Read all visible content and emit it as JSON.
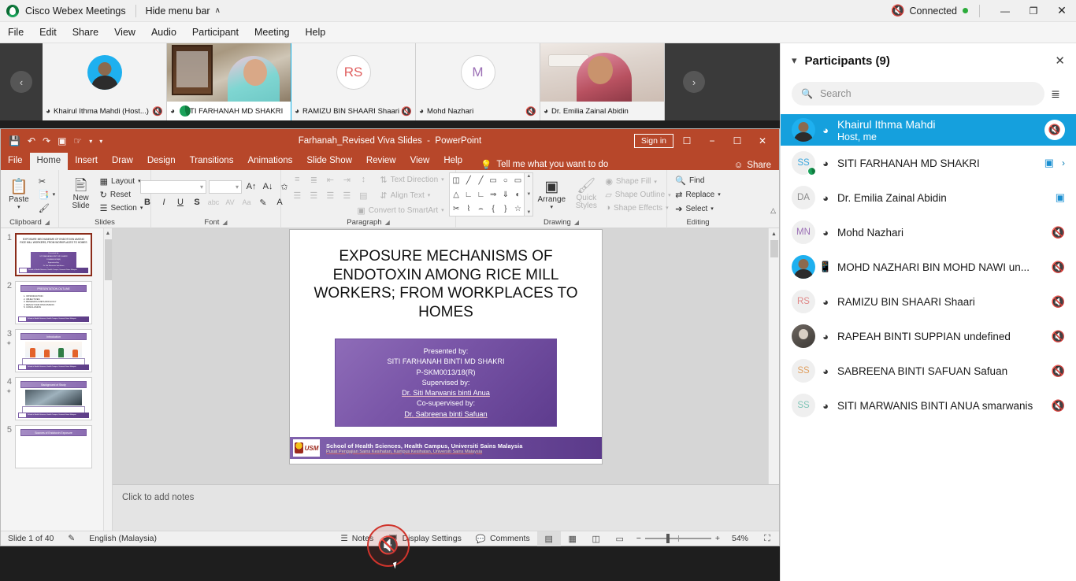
{
  "webex": {
    "app_title": "Cisco Webex Meetings",
    "hide_menu_label": "Hide menu bar",
    "chevron": "∧",
    "connection_status": "Connected",
    "menus": [
      "File",
      "Edit",
      "Share",
      "View",
      "Audio",
      "Participant",
      "Meeting",
      "Help"
    ],
    "window_controls": {
      "minimize": "—",
      "restore": "❐",
      "close": "✕"
    }
  },
  "filmstrip": {
    "prev_label": "‹",
    "next_label": "›",
    "tiles": [
      {
        "name": "Khairul Ithma Mahdi",
        "suffix": "(Host...)",
        "initials": "",
        "muted": true,
        "video": false,
        "avatar": "photo"
      },
      {
        "name": "SITI FARHANAH MD SHAKRI",
        "suffix": "",
        "initials": "",
        "muted": false,
        "video": true,
        "avatar": "video-a"
      },
      {
        "name": "RAMIZU BIN SHAARI Shaari",
        "suffix": "",
        "initials": "RS",
        "muted": true,
        "video": false,
        "avatar": "initials"
      },
      {
        "name": "Mohd Nazhari",
        "suffix": "",
        "initials": "M",
        "muted": true,
        "video": false,
        "avatar": "initials"
      },
      {
        "name": "Dr. Emilia Zainal Abidin",
        "suffix": "",
        "initials": "",
        "muted": false,
        "video": true,
        "avatar": "video-b"
      }
    ]
  },
  "powerpoint": {
    "document_name": "Farhanah_Revised Viva Slides",
    "app_suffix": "PowerPoint",
    "sign_in": "Sign in",
    "share": "Share",
    "tell_me": "Tell me what you want to do",
    "tabs": [
      "File",
      "Home",
      "Insert",
      "Draw",
      "Design",
      "Transitions",
      "Animations",
      "Slide Show",
      "Review",
      "View",
      "Help"
    ],
    "active_tab": "Home",
    "ribbon_groups": [
      {
        "label": "Clipboard",
        "items": [
          "Paste",
          "Cut",
          "Copy",
          "Format Painter"
        ]
      },
      {
        "label": "Slides",
        "items": [
          "New Slide",
          "Layout",
          "Reset",
          "Section"
        ]
      },
      {
        "label": "Font",
        "items": [
          "Bold",
          "Italic",
          "Underline",
          "Shadow",
          "Strikethrough",
          "Character Spacing",
          "Change Case",
          "Text Highlight Color",
          "Font Color"
        ]
      },
      {
        "label": "Paragraph",
        "items": [
          "Bullets",
          "Numbering",
          "Decrease Indent",
          "Increase Indent",
          "Line Spacing",
          "Text Direction",
          "Align Text",
          "Convert to SmartArt"
        ]
      },
      {
        "label": "Drawing",
        "items": [
          "Arrange",
          "Quick Styles",
          "Shape Fill",
          "Shape Outline",
          "Shape Effects"
        ]
      },
      {
        "label": "Editing",
        "items": [
          "Find",
          "Replace",
          "Select"
        ]
      }
    ],
    "font_group_labels": {
      "text_direction": "Text Direction",
      "align_text": "Align Text",
      "convert_smartart": "Convert to SmartArt"
    },
    "drawing_labels": {
      "arrange": "Arrange",
      "quick_styles": "Quick Styles",
      "shape_fill": "Shape Fill",
      "shape_outline": "Shape Outline",
      "shape_effects": "Shape Effects"
    },
    "editing_labels": {
      "find": "Find",
      "replace": "Replace",
      "select": "Select"
    },
    "slides_labels": {
      "new_slide": "New Slide",
      "layout": "Layout",
      "reset": "Reset",
      "section": "Section"
    },
    "clipboard_labels": {
      "paste": "Paste"
    },
    "thumbnails": [
      {
        "number": "1",
        "starred": false,
        "selected": true,
        "kind": "title"
      },
      {
        "number": "2",
        "starred": false,
        "selected": false,
        "kind": "outline",
        "heading": "PRESENTATION OUTLINE",
        "items": [
          "1. INTRODUCTION",
          "2. OBJECTIVES",
          "3. RESEARCH METHODOLOGY",
          "4. RESULT AND DISCUSSION",
          "5. CONCLUSION"
        ]
      },
      {
        "number": "3",
        "starred": true,
        "selected": false,
        "kind": "content",
        "heading": "Introduction"
      },
      {
        "number": "4",
        "starred": true,
        "selected": false,
        "kind": "content",
        "heading": "Background of Study"
      },
      {
        "number": "5",
        "starred": false,
        "selected": false,
        "kind": "heading-only",
        "heading": "Sources of Endotoxin Exposure"
      }
    ],
    "slide": {
      "title": "EXPOSURE MECHANISMS OF ENDOTOXIN AMONG RICE MILL WORKERS; FROM WORKPLACES TO HOMES",
      "presenter_block": [
        {
          "text": "Presented by:",
          "underline": false
        },
        {
          "text": "SITI FARHANAH BINTI MD SHAKRI",
          "underline": false
        },
        {
          "text": "P-SKM0013/18(R)",
          "underline": false
        },
        {
          "text": "Supervised by:",
          "underline": false
        },
        {
          "text": "Dr. Siti Marwanis binti Anua",
          "underline": true
        },
        {
          "text": "Co-supervised by:",
          "underline": false
        },
        {
          "text": "Dr. Sabreena binti Safuan",
          "underline": true
        }
      ],
      "banner_line1": "School of Health Sciences,  Health Campus, Universiti Sains Malaysia",
      "banner_line2": "Pusat Pengajian Sains Kesihatan, Kampus Kesihatan, Universiti Sains Malaysia",
      "banner_logo_text": "USM"
    },
    "notes_placeholder": "Click to add notes",
    "status": {
      "slide_counter": "Slide 1 of 40",
      "language": "English (Malaysia)",
      "notes_label": "Notes",
      "display_settings_label": "Display Settings",
      "comments_label": "Comments",
      "zoom_level": "54%",
      "zoom_out": "−",
      "zoom_in": "+"
    }
  },
  "participants": {
    "panel_title": "Participants (9)",
    "search_placeholder": "Search",
    "list": [
      {
        "name": "Khairul Ithma Mahdi",
        "sub": "Host, me",
        "initials": "",
        "avatar": "photo1",
        "device": "headset",
        "muted": true,
        "video": false,
        "host": true
      },
      {
        "name": "SITI FARHANAH MD SHAKRI",
        "sub": "",
        "initials": "SS",
        "avatar": "initials",
        "device": "headset",
        "muted": false,
        "video": true,
        "host": false,
        "more": true,
        "initials_color": "#3aa6dd",
        "badge": true
      },
      {
        "name": "Dr. Emilia Zainal Abidin",
        "sub": "",
        "initials": "DA",
        "avatar": "initials",
        "device": "headset",
        "muted": false,
        "video": true,
        "host": false,
        "initials_color": "#8b8b8b"
      },
      {
        "name": "Mohd Nazhari",
        "sub": "",
        "initials": "MN",
        "avatar": "initials",
        "device": "headset",
        "muted": true,
        "video": false,
        "host": false,
        "initials_color": "#9b6fb5"
      },
      {
        "name": "MOHD NAZHARI BIN MOHD NAWI un...",
        "sub": "",
        "initials": "",
        "avatar": "photo1",
        "device": "phone",
        "muted": true,
        "video": false,
        "host": false
      },
      {
        "name": "RAMIZU BIN SHAARI Shaari",
        "sub": "",
        "initials": "RS",
        "avatar": "initials",
        "device": "headset",
        "muted": true,
        "video": false,
        "host": false,
        "initials_color": "#e08a8a"
      },
      {
        "name": "RAPEAH BINTI SUPPIAN undefined",
        "sub": "",
        "initials": "",
        "avatar": "photo2",
        "device": "headset",
        "muted": true,
        "video": false,
        "host": false
      },
      {
        "name": "SABREENA BINTI SAFUAN Safuan",
        "sub": "",
        "initials": "SS",
        "avatar": "initials",
        "device": "headset",
        "muted": true,
        "video": false,
        "host": false,
        "initials_color": "#e0a060"
      },
      {
        "name": "SITI MARWANIS BINTI ANUA smarwanis",
        "sub": "",
        "initials": "SS",
        "avatar": "initials",
        "device": "headset",
        "muted": true,
        "video": false,
        "host": false,
        "initials_color": "#7fc6b8"
      }
    ]
  },
  "colors": {
    "webex_accent": "#15a0dd",
    "powerpoint_red": "#b7472a",
    "mute_red": "#d0342c",
    "connected_green": "#2bab3a",
    "slide_purple": "#6a4794"
  },
  "floating_mic": {
    "label": "muted-microphone"
  }
}
